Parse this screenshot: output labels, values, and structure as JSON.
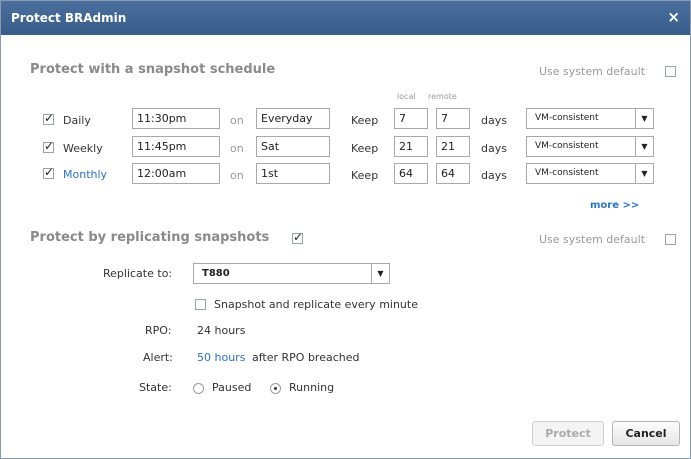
{
  "dialog": {
    "title": "Protect BRAdmin",
    "close_glyph": "×"
  },
  "snapshot": {
    "heading": "Protect with a snapshot schedule",
    "use_default_label": "Use system default",
    "use_default_checked": false,
    "col_local": "local",
    "col_remote": "remote",
    "rows": [
      {
        "checked": true,
        "name": "Daily",
        "highlight": false,
        "time": "11:30pm",
        "on": "on",
        "day": "Everyday",
        "keep": "Keep",
        "local": "7",
        "remote": "7",
        "days": "days",
        "consistency": "VM-consistent"
      },
      {
        "checked": true,
        "name": "Weekly",
        "highlight": false,
        "time": "11:45pm",
        "on": "on",
        "day": "Sat",
        "keep": "Keep",
        "local": "21",
        "remote": "21",
        "days": "days",
        "consistency": "VM-consistent"
      },
      {
        "checked": true,
        "name": "Monthly",
        "highlight": true,
        "time": "12:00am",
        "on": "on",
        "day": "1st",
        "keep": "Keep",
        "local": "64",
        "remote": "64",
        "days": "days",
        "consistency": "VM-consistent"
      }
    ],
    "more_link": "more >>"
  },
  "replication": {
    "heading": "Protect by replicating snapshots",
    "heading_checked": true,
    "use_default_label": "Use system default",
    "use_default_checked": false,
    "replicate_to_label": "Replicate to:",
    "replicate_to_value": "T880",
    "every_minute_label": "Snapshot and replicate every minute",
    "every_minute_checked": false,
    "rpo_label": "RPO:",
    "rpo_value": "24 hours",
    "alert_label": "Alert:",
    "alert_link": "50 hours",
    "alert_suffix": "after RPO breached",
    "state_label": "State:",
    "state_options": [
      "Paused",
      "Running"
    ],
    "state_selected": "Running"
  },
  "buttons": {
    "protect": "Protect",
    "cancel": "Cancel"
  },
  "icons": {
    "dropdown": "chevron-down-icon",
    "check": "checkmark-icon",
    "close": "close-icon"
  },
  "colors": {
    "titlebar": "#3f6593",
    "link": "#2a73c0",
    "section_heading": "#8a8a8a"
  }
}
